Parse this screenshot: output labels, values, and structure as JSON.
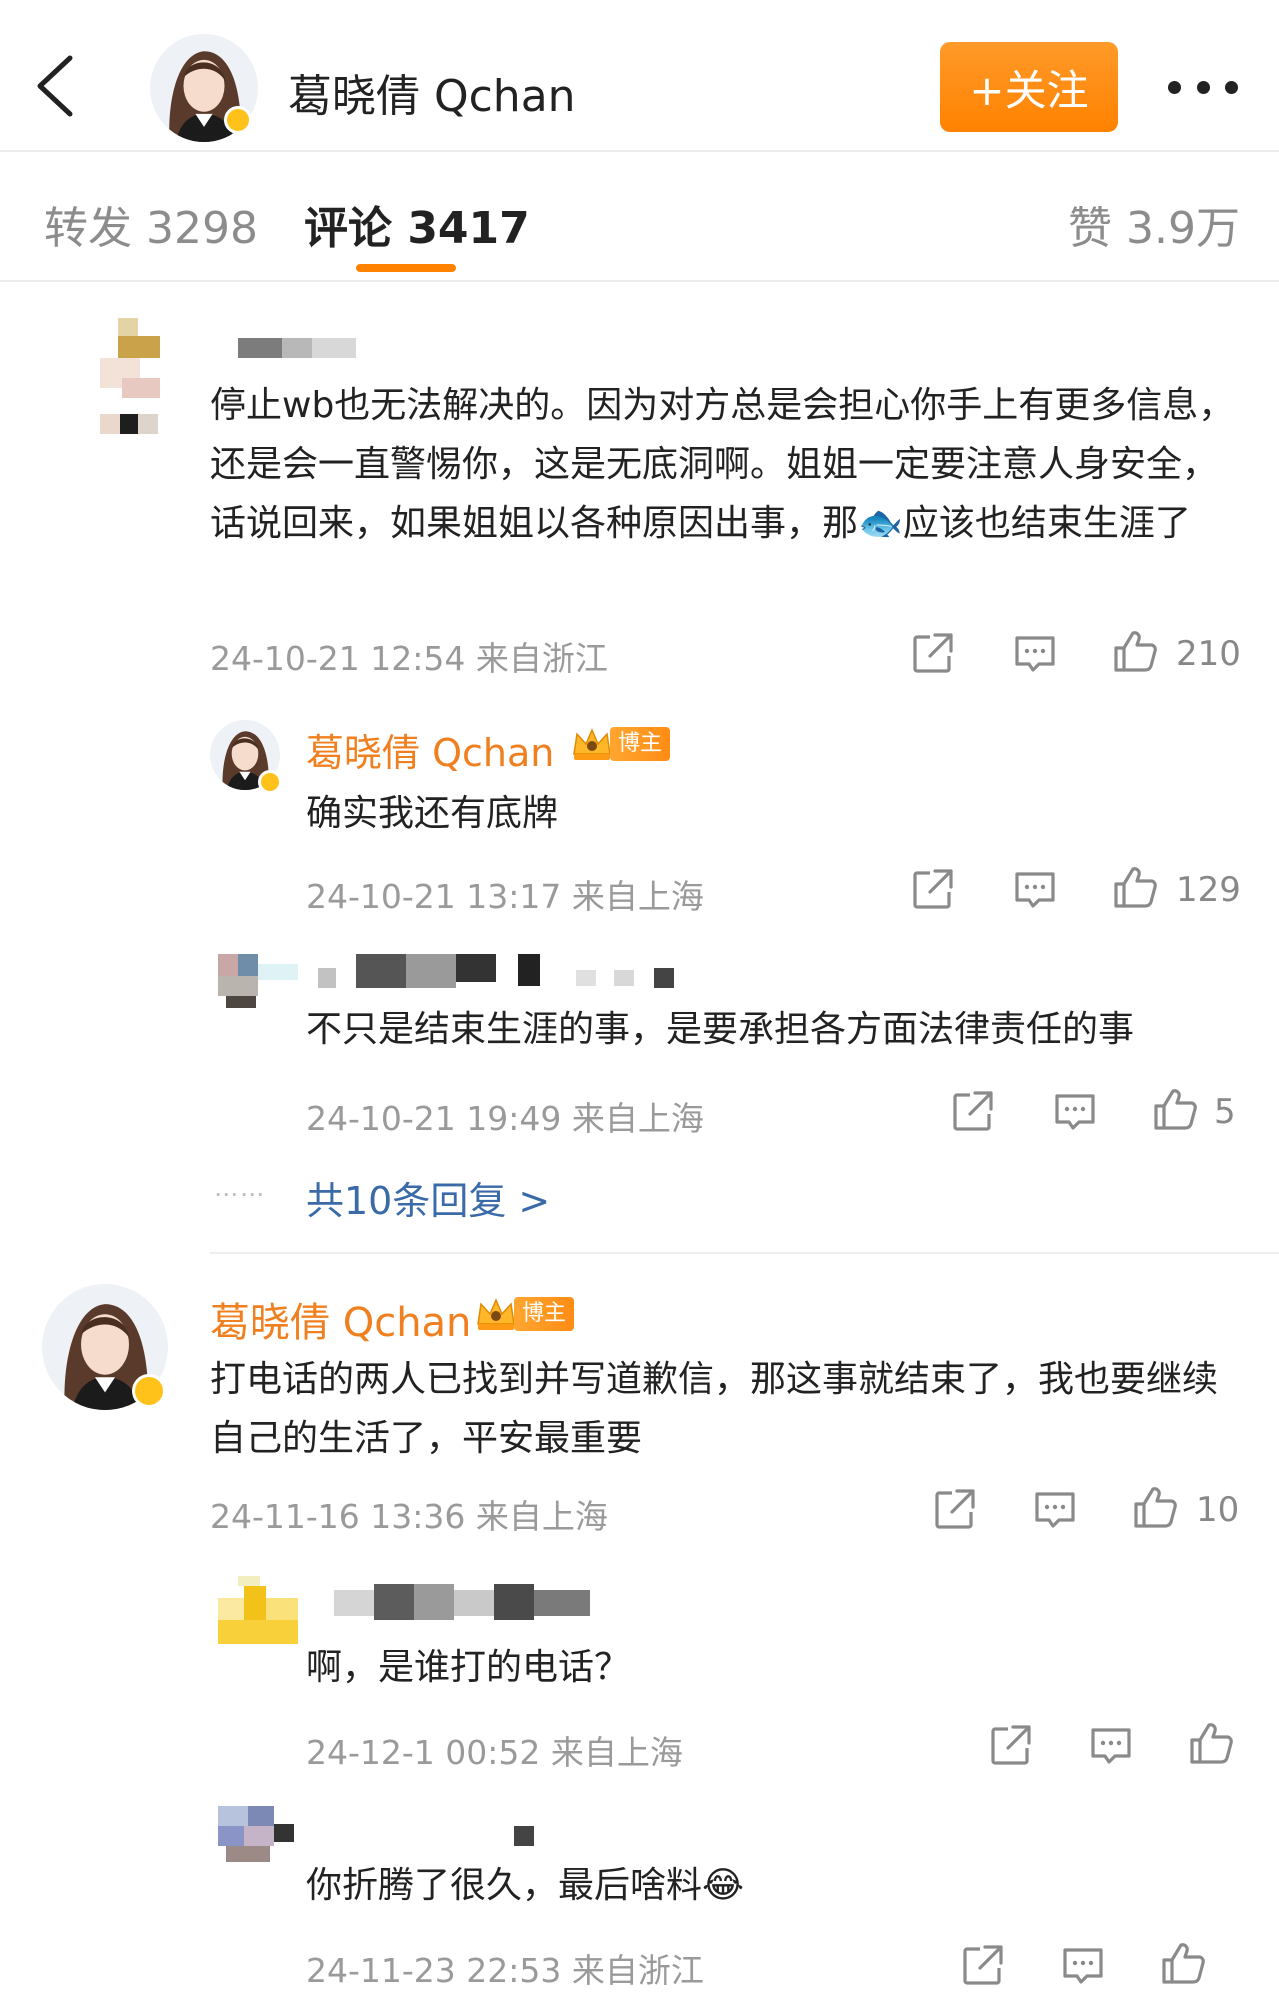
{
  "header": {
    "title": "葛晓倩 Qchan",
    "follow_label": "+关注"
  },
  "tabs": [
    {
      "label": "转发 3298"
    },
    {
      "label": "评论 3417"
    },
    {
      "label": "赞 3.9万"
    }
  ],
  "comments": [
    {
      "text": "停止wb也无法解决的。因为对方总是会担心你手上有更多信息，还是会一直警惕你，这是无底洞啊。姐姐一定要注意人身安全，话说回来，如果姐姐以各种原因出事，那🐟应该也结束生涯了",
      "meta": "24-10-21 12:54  来自浙江",
      "likes": "210",
      "replies": [
        {
          "author": "葛晓倩 Qchan",
          "badge": "博主",
          "text": "确实我还有底牌",
          "meta": "24-10-21 13:17  来自上海",
          "likes": "129"
        },
        {
          "text": "不只是结束生涯的事，是要承担各方面法律责任的事",
          "meta": "24-10-21 19:49  来自上海",
          "likes": "5"
        }
      ],
      "more_replies": "共10条回复 >"
    },
    {
      "author": "葛晓倩 Qchan",
      "badge": "博主",
      "text": "打电话的两人已找到并写道歉信，那这事就结束了，我也要继续自己的生活了，平安最重要",
      "meta": "24-11-16 13:36  来自上海",
      "likes": "10",
      "replies": [
        {
          "text": "啊，是谁打的电话？",
          "meta": "24-12-1 00:52  来自上海"
        },
        {
          "text": "你折腾了很久，最后啥料😂",
          "meta": "24-11-23 22:53  来自浙江"
        }
      ]
    }
  ],
  "icons": [
    "back-icon",
    "more-icon",
    "share-icon",
    "comment-icon",
    "like-icon",
    "crown-icon",
    "verified-icon"
  ],
  "colors": {
    "accent": "#ff8200",
    "author_name": "#f07f1f",
    "link": "#3a6aa8",
    "meta": "#9a9a9a"
  }
}
